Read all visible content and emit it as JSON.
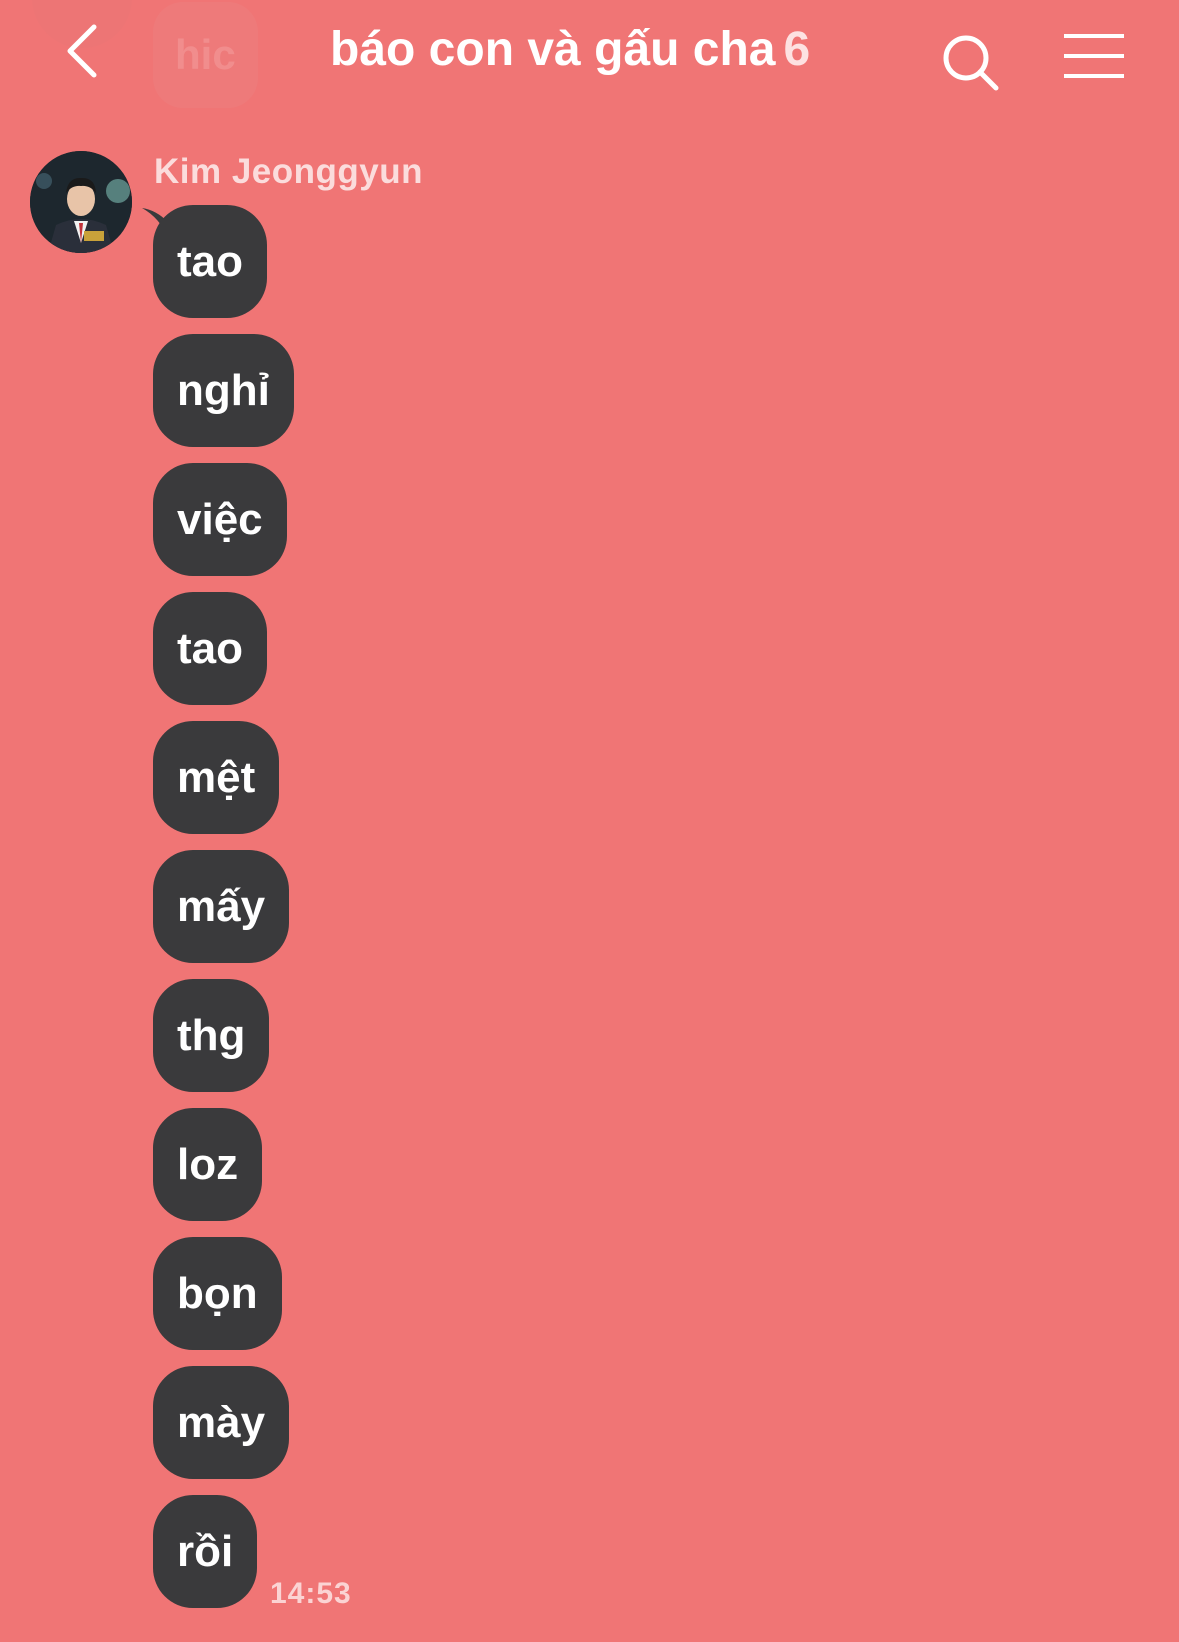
{
  "previous_message": {
    "text": "hic"
  },
  "header": {
    "title": "báo con và gấu cha",
    "member_count": "6",
    "back_icon": "chevron-left-icon",
    "search_icon": "search-icon",
    "menu_icon": "hamburger-menu-icon"
  },
  "sender": {
    "name": "Kim Jeonggyun",
    "avatar_icon": "avatar"
  },
  "messages": [
    {
      "text": "tao"
    },
    {
      "text": "nghỉ"
    },
    {
      "text": "việc"
    },
    {
      "text": "tao"
    },
    {
      "text": "mệt"
    },
    {
      "text": "mấy"
    },
    {
      "text": "thg"
    },
    {
      "text": "loz"
    },
    {
      "text": "bọn"
    },
    {
      "text": "mày"
    },
    {
      "text": "rồi"
    }
  ],
  "timestamp": "14:53",
  "colors": {
    "background": "#f07575",
    "bubble": "#3a3a3c",
    "text": "#ffffff"
  }
}
